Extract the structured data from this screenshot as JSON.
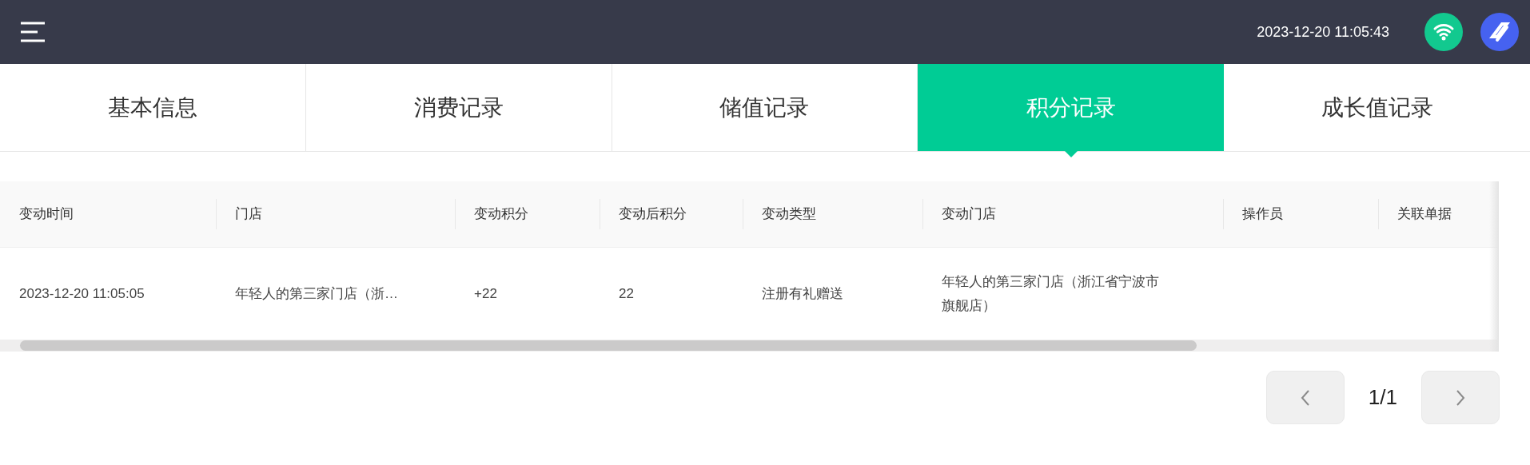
{
  "top_bar": {
    "datetime": "2023-12-20 11:05:43"
  },
  "tabs": [
    {
      "label": "基本信息",
      "selected": false
    },
    {
      "label": "消费记录",
      "selected": false
    },
    {
      "label": "储值记录",
      "selected": false
    },
    {
      "label": "积分记录",
      "selected": true
    },
    {
      "label": "成长值记录",
      "selected": false
    }
  ],
  "table": {
    "columns": [
      "变动时间",
      "门店",
      "变动积分",
      "变动后积分",
      "变动类型",
      "变动门店",
      "操作员",
      "关联单据"
    ],
    "rows": [
      [
        "2023-12-20 11:05:05",
        "年轻人的第三家门店（浙…",
        "+22",
        "22",
        "注册有礼赠送",
        "年轻人的第三家门店（浙江省宁波市旗舰店）",
        "",
        ""
      ]
    ]
  },
  "pagination": {
    "page": "1/1"
  }
}
